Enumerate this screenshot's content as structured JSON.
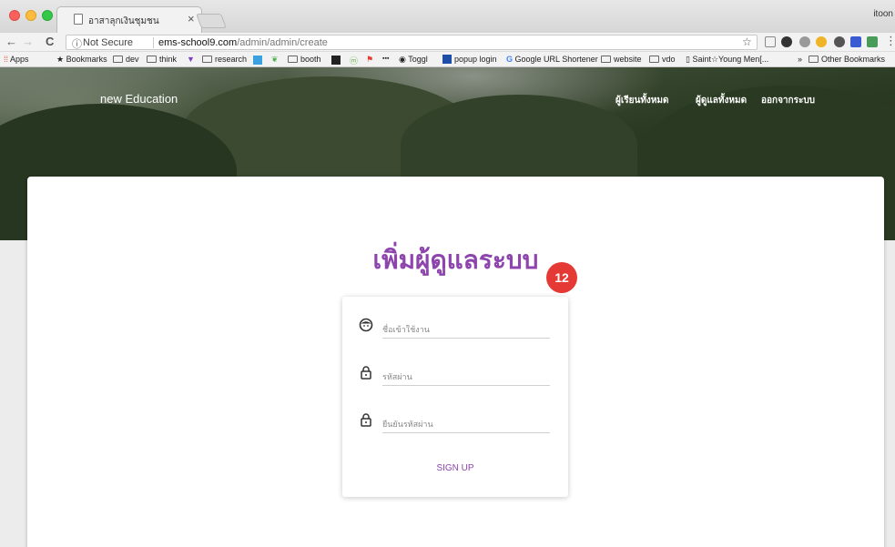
{
  "browser": {
    "tab_title": "อาสาลุกเงินชุมชน",
    "tab_close": "×",
    "profile": "itoon",
    "not_secure": "Not Secure",
    "url_domain": "ems-school9.com",
    "url_path": "/admin/admin/create",
    "nav_back": "←",
    "nav_forward": "→",
    "nav_reload": "C",
    "star": "☆",
    "more": "⋮"
  },
  "bookmarks": {
    "apps": "Apps",
    "items": [
      "Bookmarks",
      "dev",
      "think",
      "research",
      "booth",
      "Toggl",
      "popup login",
      "Google URL Shortener",
      "website",
      "vdo",
      "Saint☆Young Men[...",
      "Other Bookmarks"
    ],
    "overflow": "»"
  },
  "header": {
    "brand": "new Education",
    "nav": [
      "ผู้เรียนทั้งหมด",
      "ผู้ดูแลทั้งหมด",
      "ออกจากระบบ"
    ]
  },
  "page": {
    "title": "เพิ่มผู้ดูแลระบบ",
    "badge": "12"
  },
  "form": {
    "username_placeholder": "ชื่อเข้าใช้งาน",
    "password_placeholder": "รหัสผ่าน",
    "confirm_placeholder": "ยืนยันรหัสผ่าน",
    "submit_label": "SIGN UP"
  },
  "colors": {
    "accent": "#8e44ad",
    "badge": "#e53935"
  }
}
